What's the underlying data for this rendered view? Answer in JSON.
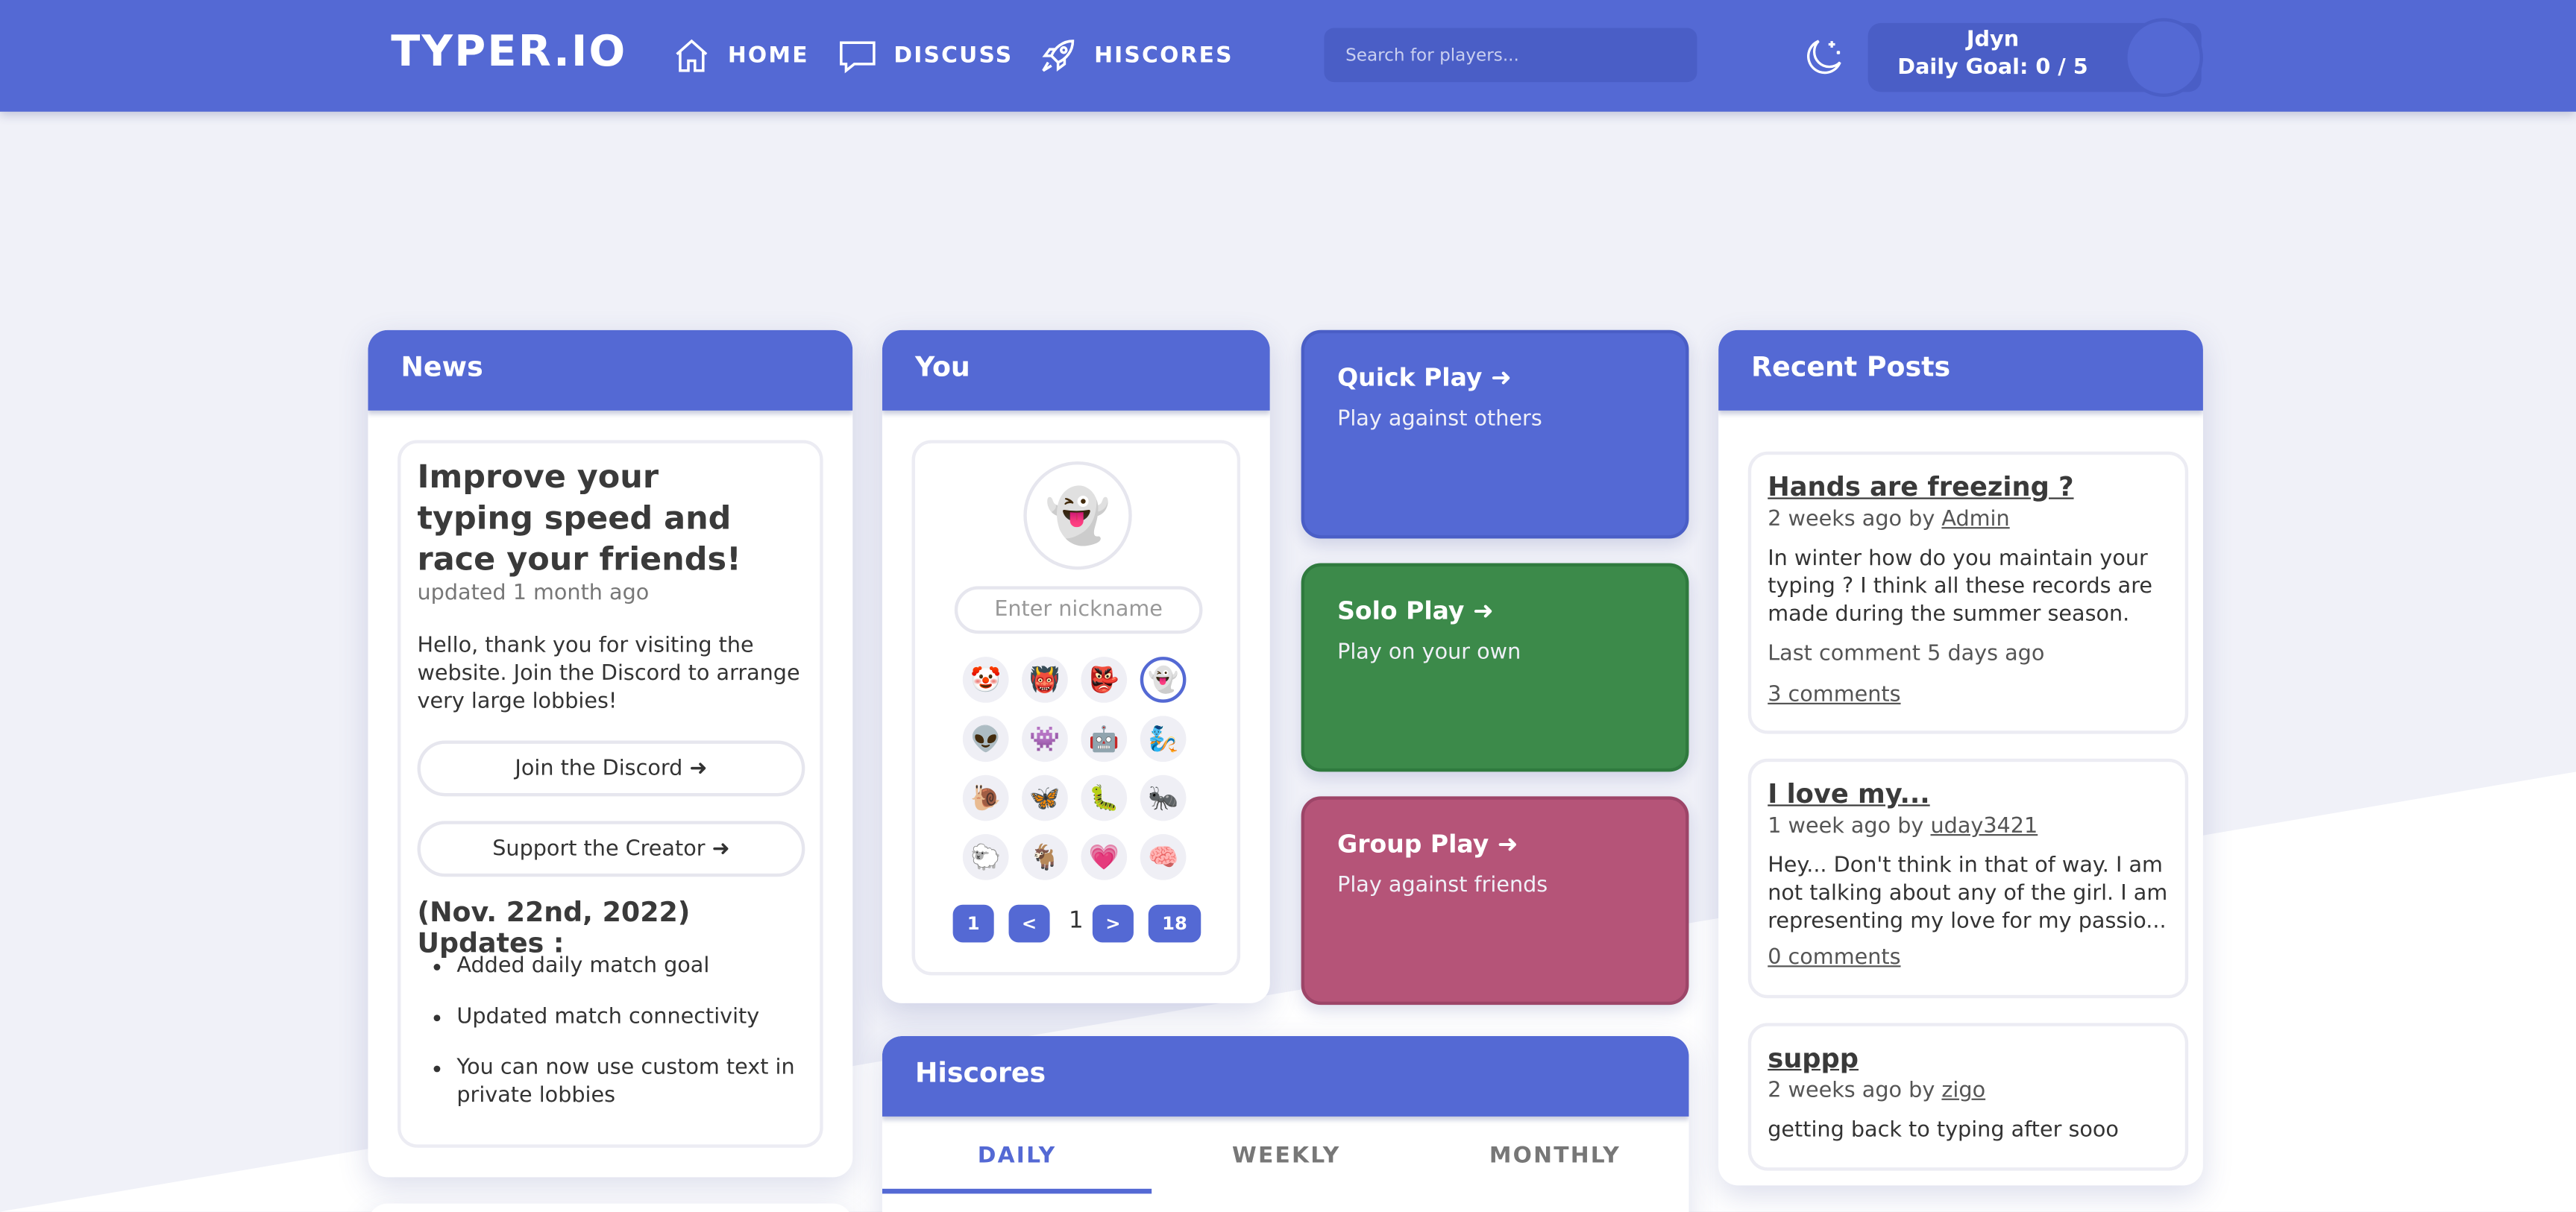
{
  "nav": {
    "logo": "TYPER.IO",
    "home": "HOME",
    "discuss": "DISCUSS",
    "hiscores": "HISCORES",
    "search_placeholder": "Search for players...",
    "user_name": "Jdyn",
    "daily_goal": "Daily Goal: 0 / 5"
  },
  "news": {
    "header": "News",
    "title": "Improve your typing speed and race your friends!",
    "updated": "updated 1 month ago",
    "body": "Hello, thank you for visiting the website. Join the Discord to arrange very large lobbies!",
    "discord_button": "Join the Discord ➜",
    "support_button": "Support the Creator ➜",
    "updates_title": "(Nov. 22nd, 2022) Updates :",
    "updates": [
      "Added daily match goal",
      "Updated match connectivity",
      "You can now use custom text in private lobbies"
    ]
  },
  "you": {
    "header": "You",
    "avatar_emoji": "👻",
    "nickname_placeholder": "Enter nickname",
    "emojis": [
      "🤡",
      "👹",
      "👺",
      "👻",
      "👽",
      "👾",
      "🤖",
      "🧞",
      "🐌",
      "🦋",
      "🐛",
      "🐜",
      "🐑",
      "🐐",
      "💗",
      "🧠"
    ],
    "selected_index": 3,
    "pagination": {
      "first": "1",
      "prev": "<",
      "current": "1",
      "next": ">",
      "last": "18"
    }
  },
  "play": {
    "quick_title": "Quick Play ➜",
    "quick_sub": "Play against others",
    "solo_title": "Solo Play ➜",
    "solo_sub": "Play on your own",
    "group_title": "Group Play ➜",
    "group_sub": "Play against friends",
    "colors": {
      "quick": "#5469d4",
      "solo": "#3c8a4a",
      "group": "#b55478"
    }
  },
  "hiscores": {
    "header": "Hiscores",
    "tabs": [
      "DAILY",
      "WEEKLY",
      "MONTHLY"
    ],
    "active_tab": "DAILY"
  },
  "posts": {
    "header": "Recent Posts",
    "items": [
      {
        "title": "Hands are freezing ?",
        "when": "2 weeks ago by",
        "author": "Admin",
        "body": "In winter how do you maintain your typing ? I think all these records are made during the summer season.",
        "last_comment": "Last comment 5 days ago",
        "comments": "3 comments"
      },
      {
        "title": "I love my...",
        "when": "1 week ago by",
        "author": "uday3421",
        "body": "Hey... Don't think in that of way. I am not talking about any of the girl. I am representing my love for my passio...",
        "comments": "0 comments"
      },
      {
        "title": "suppp",
        "when": "2 weeks ago by",
        "author": "zigo",
        "body": "getting back to typing after sooo long :/"
      }
    ]
  },
  "colors": {
    "accent": "#5469d4",
    "background": "#f0f1f8"
  }
}
